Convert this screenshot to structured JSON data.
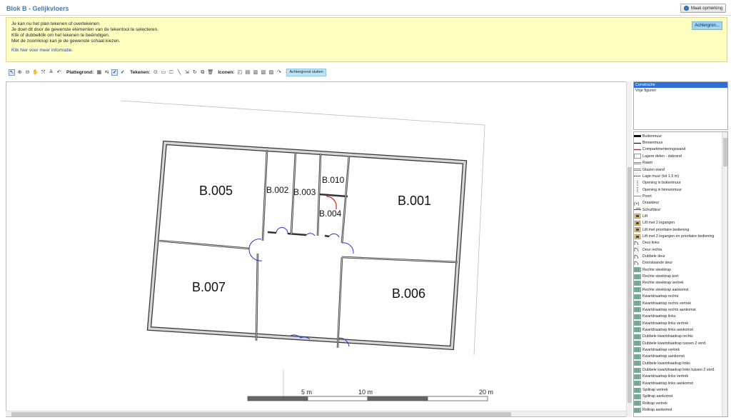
{
  "window": {
    "title": "Blok B - Gelijkvloers",
    "remark_button": "Maak opmerking"
  },
  "info": {
    "lines": [
      "Je kan nu het plan tekenen of overtekenen.",
      "Je doet dit door de gewenste elementen van de tekentool te selecteren.",
      "Klik of dubbelklik om het tekenen te beëindigen.",
      "Met de zoomknop kan je de gewenste schaal kiezen."
    ],
    "more_info_link": "Klik hier voor meer informatie.",
    "background_button": "Achtergron..."
  },
  "toolbar": {
    "plattegrond_label": "Plattegrond:",
    "tekenen_label": "Tekenen:",
    "iconen_label": "Iconen:",
    "close_background_button": "Achtergrond sluiten"
  },
  "floorplan": {
    "rooms": [
      "B.005",
      "B.002",
      "B.003",
      "B.010",
      "B.004",
      "B.001",
      "B.007",
      "B.006"
    ],
    "scale_labels": [
      "5 m",
      "10 m",
      "20 m"
    ]
  },
  "layers": [
    "Constructie",
    "Vrije figuren"
  ],
  "legend": [
    "Buitenmuur",
    "Binnenmuur",
    "Compartimenteringswand",
    "Lagere delen - dakrand",
    "Raam",
    "Glazen wand",
    "Lage muur (tot 1,5 m)",
    "Opening in buitenmuur",
    "Opening in binnenmuur",
    "Poort",
    "Draaideur",
    "Schuifdeur",
    "Lift",
    "Lift met 2 ingangen",
    "Lift met prioritaire bediening",
    "Lift met 2 ingangen en prioritaire bediening",
    "Deur links",
    "Deur rechts",
    "Dubbele deur",
    "Doorslaande deur",
    "Rechte steektrap",
    "Rechte steektrap kort",
    "Rechte steektrap vertrek",
    "Rechte steektrap aankomst",
    "Kwartdraaitrap rechts",
    "Kwartdraaitrap rechts vertrek",
    "Kwartdraaitrap rechts aankomst",
    "Kwartdraaitrap links",
    "Kwartdraaitrap links vertrek",
    "Kwartdraaitrap links aankomst",
    "Dubbele kwartdraaitrap rechts",
    "Dubbele kwartdraaitrap tussen 2 verd.",
    "Kwartdraaitrap vertrek",
    "Kwartdraaitrap aankomst",
    "Dubbele kwartdraaitrap links",
    "Dubbele kwartdraaitrap links tussen 2 verd.",
    "Kwartdraaitrap links vertrek",
    "Kwartdraaitrap links aankomst",
    "Spiltrap vertrek",
    "Spiltrap aankomst",
    "Roltrap vertrek",
    "Roltrap aankomst"
  ],
  "colors": {
    "accent": "#2f6fd6",
    "info_bg": "#ffffc0",
    "door": "#2233cc",
    "compartment": "#e02020",
    "button_bg": "#9dd6f5"
  }
}
